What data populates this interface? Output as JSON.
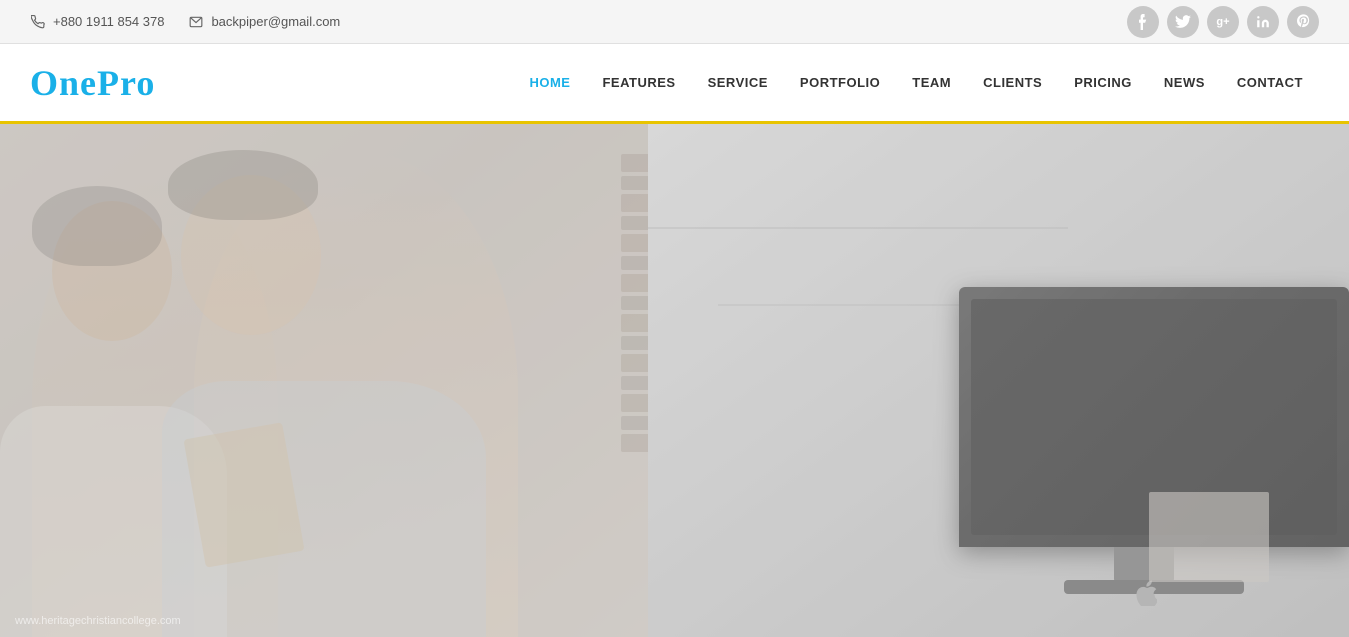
{
  "topbar": {
    "phone": "+880 1911 854 378",
    "email": "backpiper@gmail.com"
  },
  "social": [
    {
      "name": "facebook",
      "icon": "f"
    },
    {
      "name": "twitter",
      "icon": "t"
    },
    {
      "name": "google-plus",
      "icon": "g+"
    },
    {
      "name": "linkedin",
      "icon": "in"
    },
    {
      "name": "pinterest",
      "icon": "p"
    }
  ],
  "logo": "OnePro",
  "nav": {
    "items": [
      {
        "label": "HOME",
        "active": true
      },
      {
        "label": "FEATURES",
        "active": false
      },
      {
        "label": "SERVICE",
        "active": false
      },
      {
        "label": "PORTFOLIO",
        "active": false
      },
      {
        "label": "TEAM",
        "active": false
      },
      {
        "label": "CLIENTS",
        "active": false
      },
      {
        "label": "PRICING",
        "active": false
      },
      {
        "label": "NEWS",
        "active": false
      },
      {
        "label": "CONTACT",
        "active": false
      }
    ]
  },
  "hero": {
    "watermark": "www.heritagechristiancollege.com"
  },
  "colors": {
    "accent_yellow": "#e8c400",
    "accent_blue": "#1ab0e8",
    "nav_text": "#333333",
    "topbar_bg": "#f5f5f5",
    "social_bg": "#c8c8c8"
  }
}
